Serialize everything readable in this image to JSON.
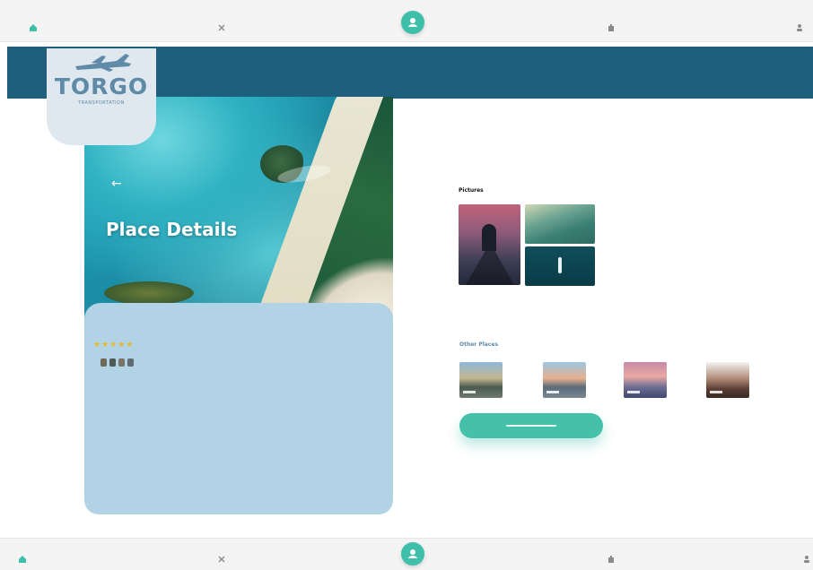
{
  "nav": {
    "items": [
      {
        "icon": "home-icon",
        "label": ""
      },
      {
        "icon": "close-icon",
        "label": ""
      },
      {
        "icon": "center-action-icon",
        "label": ""
      },
      {
        "icon": "building-icon",
        "label": ""
      },
      {
        "icon": "person-icon",
        "label": ""
      }
    ]
  },
  "brand": {
    "logo_text": "TORGO",
    "logo_subtitle": "TRANSPORTATION"
  },
  "hero": {
    "title": "Place Details",
    "back_glyph": "←"
  },
  "details": {
    "stars": "★★★★★",
    "rating_label": "",
    "tag_caption": "",
    "description": "",
    "description_link": ""
  },
  "pictures": {
    "label": "Pictures"
  },
  "other_places": {
    "label": "Other Places"
  },
  "cta": {
    "label": ""
  },
  "colors": {
    "accent": "#44c1a8",
    "header": "#1e5f7d",
    "card": "#b2d3e5",
    "star": "#e8b82a",
    "logo": "#5f8aa8"
  }
}
